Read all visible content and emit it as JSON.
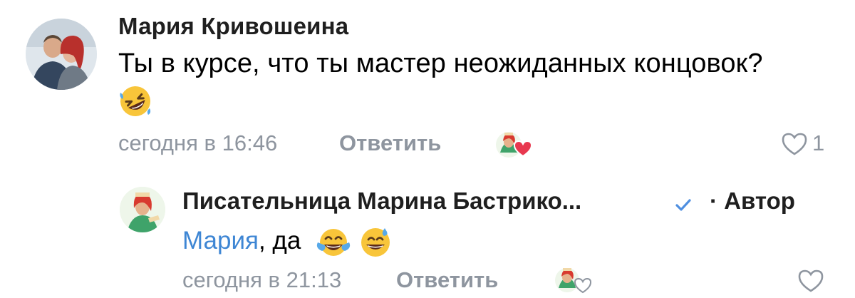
{
  "comments": [
    {
      "author": "Мария Кривошеина",
      "text": "Ты в курсе, что ты мастер неожиданных концовок?",
      "emoji": "rolling-on-floor-laughing",
      "time": "сегодня в 16:46",
      "reply_label": "Ответить",
      "reaction": "avatar-with-heart",
      "likes": "1",
      "liked": false
    },
    {
      "author": "Писательница Марина Бастрико...",
      "verified": true,
      "author_tag": "· Автор",
      "mention": "Мария",
      "text": ", да",
      "emojis": [
        "face-with-tears-of-joy",
        "grinning-face-with-sweat"
      ],
      "time": "сегодня в 21:13",
      "reply_label": "Ответить",
      "reaction": "avatar-with-empty-heart",
      "liked": false
    }
  ],
  "colors": {
    "meta_gray": "#8e959f",
    "mention_blue": "#3e86d4",
    "heart_red": "#e8384f",
    "verified_blue": "#4f8fe0"
  }
}
